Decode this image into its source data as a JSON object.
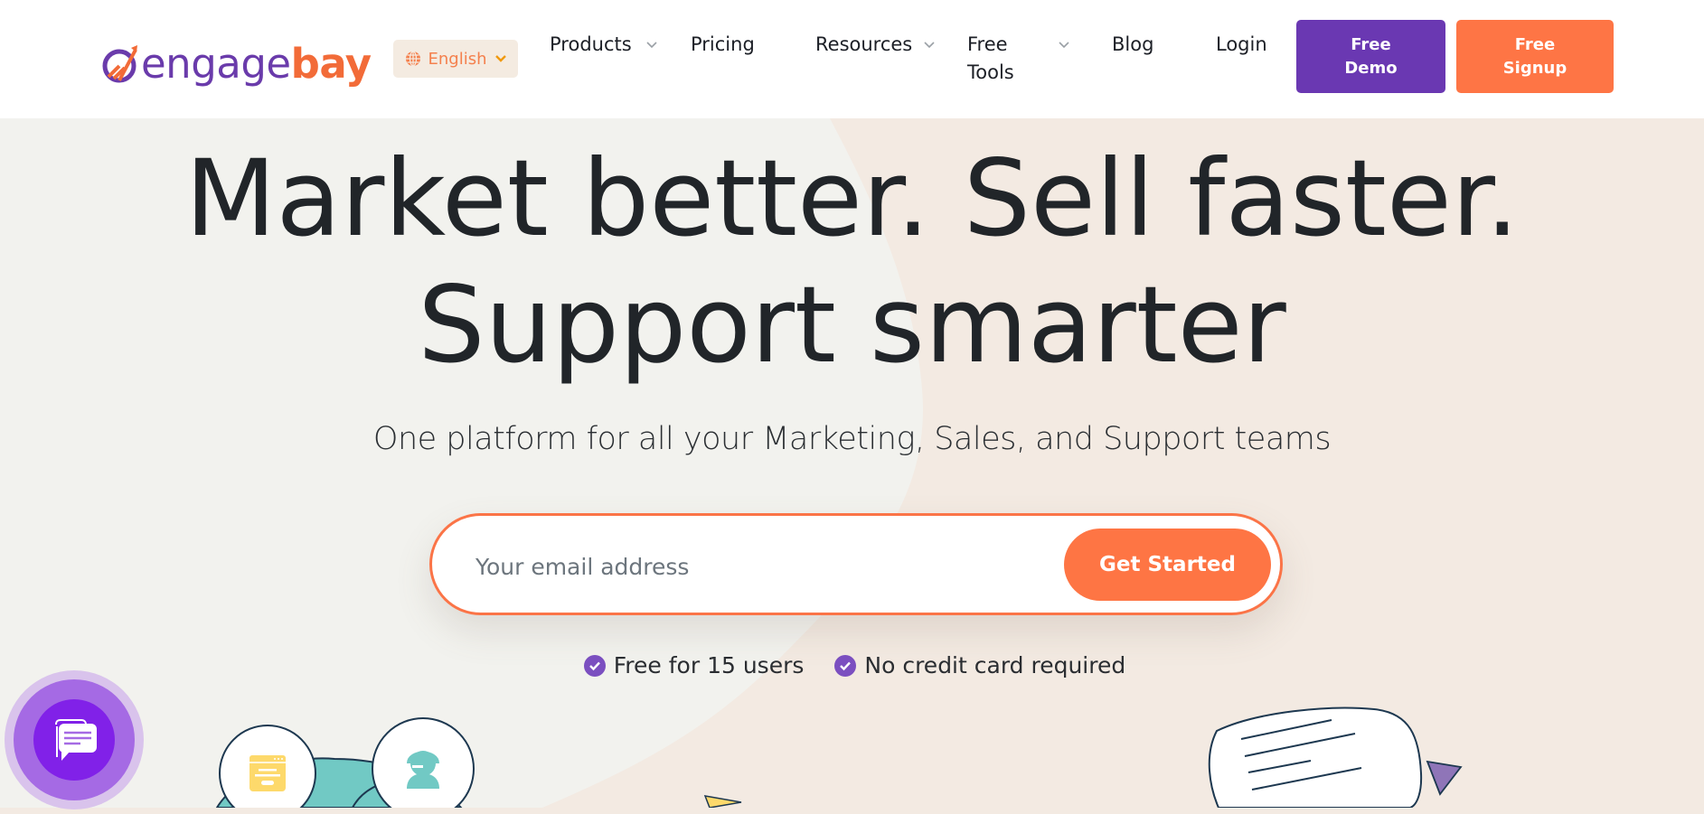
{
  "header": {
    "logo": {
      "part1": "engage",
      "part2": "bay",
      "alt": "engagebay"
    },
    "language": {
      "label": "English",
      "icon": "globe-icon"
    },
    "nav": [
      {
        "label": "Products",
        "has_dropdown": true
      },
      {
        "label": "Pricing",
        "has_dropdown": false
      },
      {
        "label": "Resources",
        "has_dropdown": true
      },
      {
        "label": "Free Tools",
        "line1": "Free",
        "line2": "Tools",
        "has_dropdown": true
      },
      {
        "label": "Blog",
        "has_dropdown": false
      },
      {
        "label": "Login",
        "has_dropdown": false
      }
    ],
    "demo_button": {
      "line1": "Free",
      "line2": "Demo"
    },
    "signup_button": {
      "line1": "Free",
      "line2": "Signup"
    }
  },
  "hero": {
    "title_line1": "Market better. Sell faster.",
    "title_line2": "Support smarter",
    "subtitle": "One platform for all your Marketing, Sales, and Support teams",
    "email_placeholder": "Your email address",
    "email_value": "",
    "cta_label": "Get Started",
    "perks": [
      {
        "label": "Free for 15 users",
        "icon": "check-circle-icon"
      },
      {
        "label": "No credit card required",
        "icon": "check-circle-icon"
      }
    ]
  },
  "colors": {
    "brand_purple": "#6a38b2",
    "brand_orange": "#fe7545",
    "text_dark": "#212529",
    "bg_left": "#f2f2ee",
    "bg_right": "#f3eae2",
    "teal": "#71c9c4",
    "yellow": "#fdd96b"
  },
  "widgets": {
    "chat_button": {
      "icon": "chat-bubble-icon"
    }
  }
}
